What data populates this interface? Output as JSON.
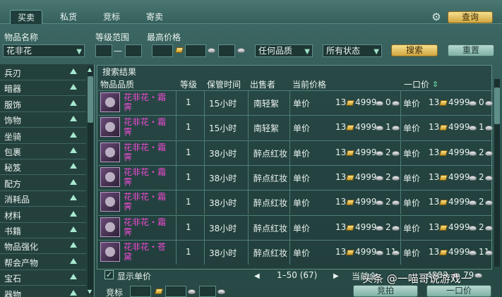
{
  "tabs": [
    "买卖",
    "私货",
    "竞标",
    "寄卖"
  ],
  "active_tab": 0,
  "top_right": {
    "query_label": "查询"
  },
  "filters": {
    "name_label": "物品名称",
    "name_value": "花非花",
    "level_label": "等级范围",
    "level_dash": "—",
    "max_price_label": "最高价格",
    "quality_value": "任何品质",
    "status_value": "所有状态",
    "search_label": "搜索",
    "reset_label": "重置"
  },
  "categories": [
    "兵刃",
    "暗器",
    "服饰",
    "饰物",
    "坐骑",
    "包裹",
    "秘笈",
    "配方",
    "消耗品",
    "材料",
    "书籍",
    "物品强化",
    "帮会产物",
    "宝石",
    "器物"
  ],
  "results": {
    "title": "搜索结果",
    "headers": [
      "物品品质",
      "等级",
      "保管时间",
      "出售者",
      "当前价格",
      "一口价"
    ],
    "rows": [
      {
        "name": "花非花・霜霁",
        "level": "1",
        "time": "15小时",
        "seller": "南轻絮",
        "cur_label": "单价",
        "cur_gold": "13",
        "cur_silver": "4999",
        "cur_copper": "0",
        "buy_label": "单价",
        "buy_gold": "13",
        "buy_silver": "4999",
        "buy_copper": "0"
      },
      {
        "name": "花非花・霜霁",
        "level": "1",
        "time": "15小时",
        "seller": "南轻絮",
        "cur_label": "单价",
        "cur_gold": "13",
        "cur_silver": "4999",
        "cur_copper": "1",
        "buy_label": "单价",
        "buy_gold": "13",
        "buy_silver": "4999",
        "buy_copper": "1"
      },
      {
        "name": "花非花・霜霁",
        "level": "1",
        "time": "38小时",
        "seller": "醉点红妆",
        "cur_label": "单价",
        "cur_gold": "13",
        "cur_silver": "4999",
        "cur_copper": "2",
        "buy_label": "单价",
        "buy_gold": "13",
        "buy_silver": "4999",
        "buy_copper": "2"
      },
      {
        "name": "花非花・霜霁",
        "level": "1",
        "time": "38小时",
        "seller": "醉点红妆",
        "cur_label": "单价",
        "cur_gold": "13",
        "cur_silver": "4999",
        "cur_copper": "2",
        "buy_label": "单价",
        "buy_gold": "13",
        "buy_silver": "4999",
        "buy_copper": "2"
      },
      {
        "name": "花非花・霜霁",
        "level": "1",
        "time": "38小时",
        "seller": "醉点红妆",
        "cur_label": "单价",
        "cur_gold": "13",
        "cur_silver": "4999",
        "cur_copper": "2",
        "buy_label": "单价",
        "buy_gold": "13",
        "buy_silver": "4999",
        "buy_copper": "2"
      },
      {
        "name": "花非花・霜霁",
        "level": "1",
        "time": "38小时",
        "seller": "醉点红妆",
        "cur_label": "单价",
        "cur_gold": "13",
        "cur_silver": "4999",
        "cur_copper": "2",
        "buy_label": "单价",
        "buy_gold": "13",
        "buy_silver": "4999",
        "buy_copper": "2"
      },
      {
        "name": "花非花・苍黛",
        "level": "1",
        "time": "38小时",
        "seller": "醉点红妆",
        "cur_label": "单价",
        "cur_gold": "13",
        "cur_silver": "4999",
        "cur_copper": "11",
        "buy_label": "单价",
        "buy_gold": "13",
        "buy_silver": "4999",
        "buy_copper": "11"
      }
    ]
  },
  "footer": {
    "show_unit_label": "显示单价",
    "pager_text": "1–50 (67)",
    "current_label": "当前余",
    "balance_silver": "4883",
    "balance_copper": "79",
    "bid_label": "竞标",
    "bid_button": "竞拍",
    "buyout_button": "一口价"
  },
  "watermark": "头条 @一喵哥说游戏一"
}
